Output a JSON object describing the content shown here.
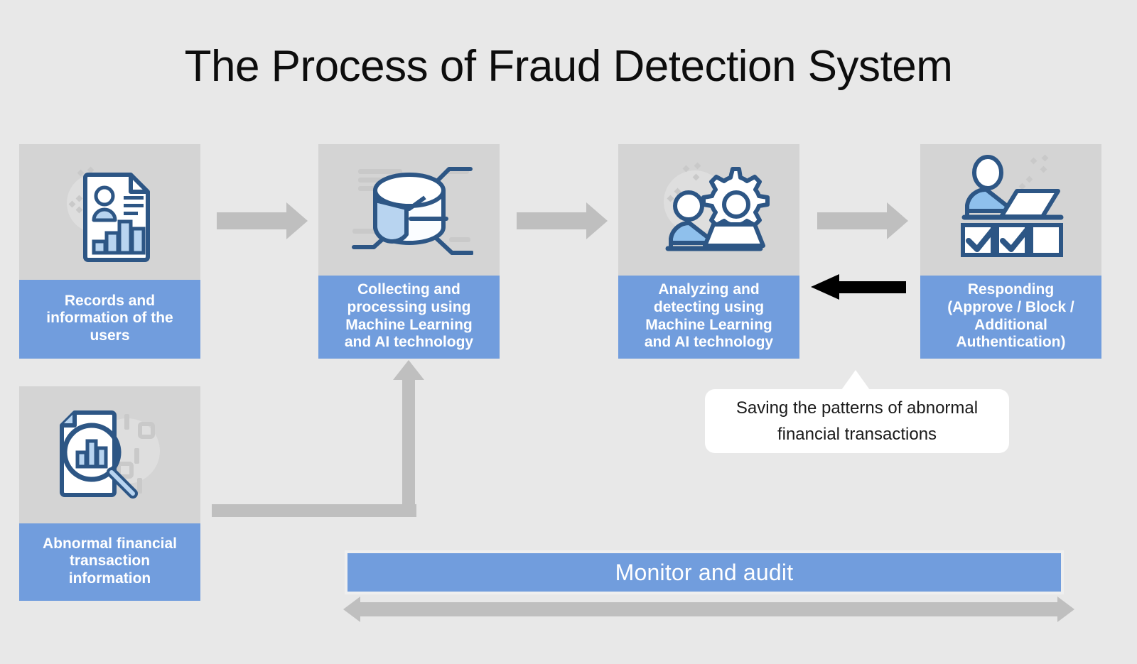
{
  "title": "The Process of Fraud Detection System",
  "colors": {
    "background": "#e8e8e8",
    "card_body": "#d4d4d4",
    "accent_blue": "#719ddd",
    "icon_outline": "#2d5685",
    "icon_fill": "#b8d4f0",
    "arrow_gray": "#bfbfbf",
    "arrow_black": "#000000",
    "callout_bg": "#ffffff",
    "label_text": "#ffffff"
  },
  "cards": [
    {
      "id": "records",
      "label": "Records and\ninformation of the\nusers",
      "icon": "document-person-chart-icon"
    },
    {
      "id": "collecting",
      "label": "Collecting and\nprocessing using\nMachine Learning\nand AI technology",
      "icon": "database-pie-cylinder-icon"
    },
    {
      "id": "analyzing",
      "label": "Analyzing and\ndetecting using\nMachine Learning\nand AI technology",
      "icon": "person-laptop-gear-icon"
    },
    {
      "id": "responding",
      "label": "Responding\n(Approve / Block /\nAdditional\nAuthentication)",
      "icon": "person-laptop-checkboxes-icon"
    },
    {
      "id": "abnormal",
      "label": "Abnormal financial\ntransaction\ninformation",
      "icon": "document-magnifier-chart-icon"
    }
  ],
  "connectors": {
    "arrow_1": "arrow-right-gray-icon",
    "arrow_2": "arrow-right-gray-icon",
    "arrow_3": "arrow-right-gray-icon",
    "feedback_arrow": "arrow-left-black-icon",
    "elbow_arrow": "arrow-elbow-up-gray-icon",
    "monitor_arrow": "arrow-double-headed-gray-icon"
  },
  "callout": {
    "text": "Saving the patterns of abnormal financial transactions",
    "tail": "callout-tail-up-icon"
  },
  "monitor": {
    "label": "Monitor and audit"
  }
}
